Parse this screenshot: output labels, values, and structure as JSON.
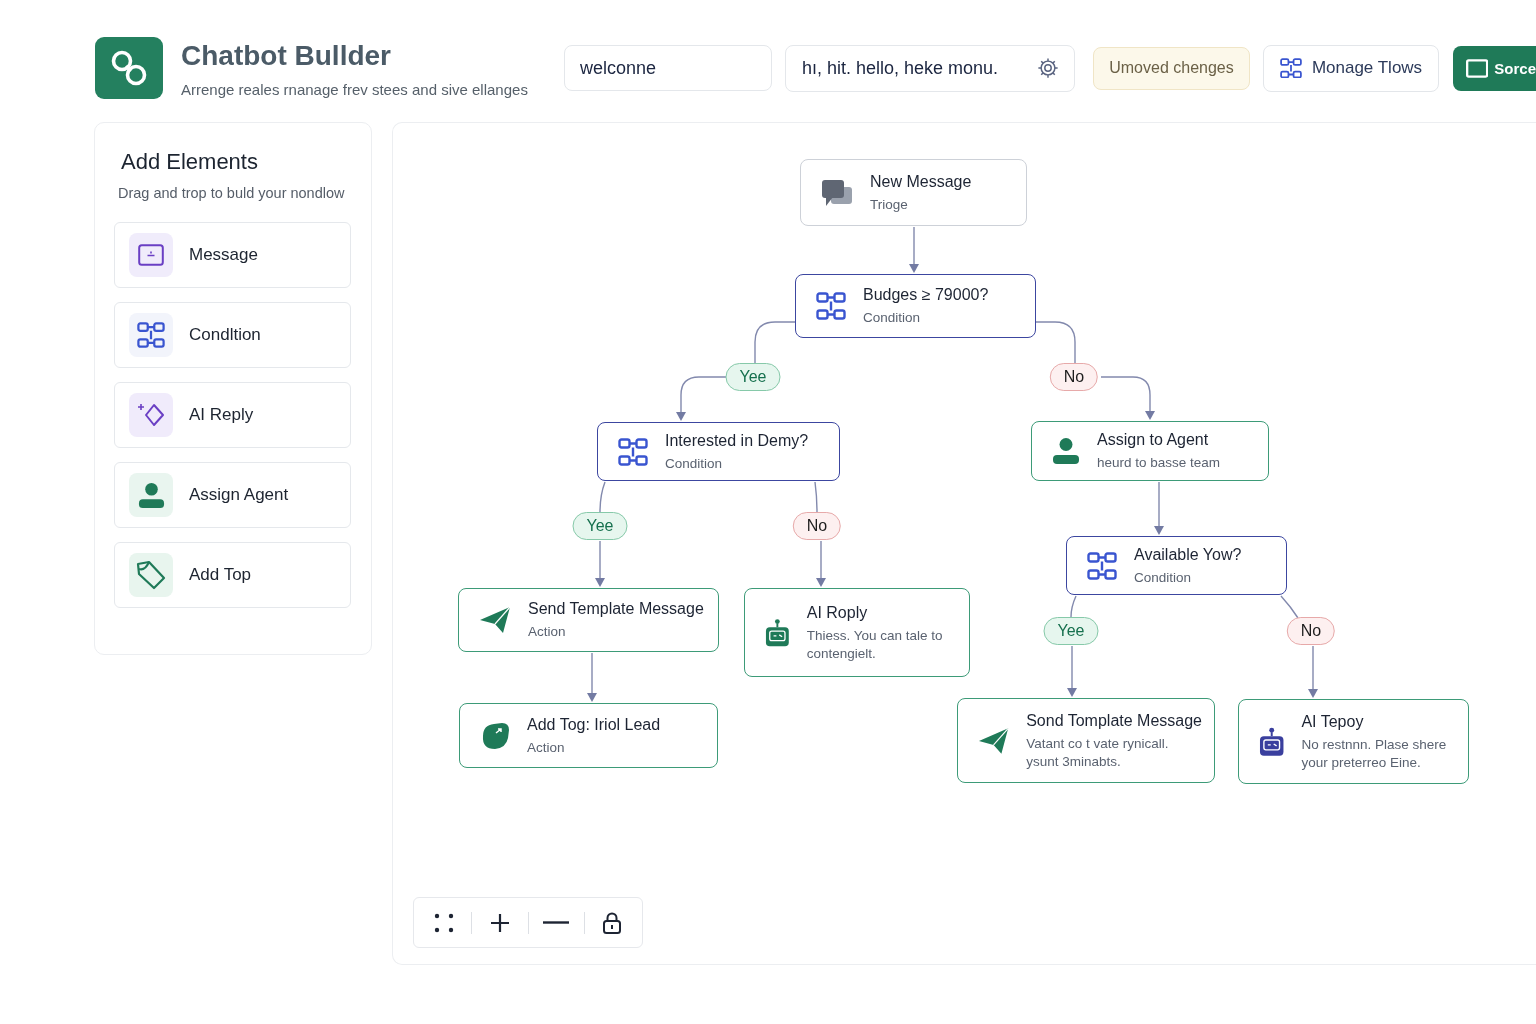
{
  "header": {
    "title": "Chatbot Bullder",
    "subtitle": "Arrenge reales rnanage frev stees and sive ellanges",
    "flow_name_field": {
      "value": "welconne"
    },
    "keywords_field": {
      "value": "hı, hit. hello, heke monu."
    },
    "status": "Umoved chenges",
    "buttons": [
      {
        "label": "Monage Tlows",
        "kind": "secondary"
      },
      {
        "label": "Sorce",
        "kind": "primary"
      }
    ]
  },
  "sidebar": {
    "title": "Add Elements",
    "subtitle": "Drag and trop to buld your nondlow",
    "items": [
      {
        "label": "Message",
        "kind": "message"
      },
      {
        "label": "Condltion",
        "kind": "condition"
      },
      {
        "label": "AI Reply",
        "kind": "ai"
      },
      {
        "label": "Assign Agent",
        "kind": "agent"
      },
      {
        "label": "Add Top",
        "kind": "tag"
      }
    ]
  },
  "flow": {
    "title": "New Message",
    "subtitle": "Trioge",
    "kind": "trigger",
    "children": [
      {
        "title": "Budges ≥ 79000?",
        "subtitle": "Condition",
        "kind": "condition",
        "children": [
          {
            "branch": {
              "label": "Yee",
              "kind": "yes"
            },
            "title": "Interested in Demy?",
            "subtitle": "Condition",
            "kind": "condition",
            "children": [
              {
                "branch": {
                  "label": "Yee",
                  "kind": "yes"
                },
                "title": "Send Template Message",
                "subtitle": "Action",
                "kind": "template",
                "children": [
                  {
                    "title": "Add Tog: Iriol Lead",
                    "subtitle": "Action",
                    "kind": "tag"
                  }
                ]
              },
              {
                "branch": {
                  "label": "No",
                  "kind": "no"
                },
                "title": "AI Roply",
                "subtitle": "Thiess. You can tale to contengielt.",
                "kind": "ai"
              }
            ]
          },
          {
            "branch": {
              "label": "No",
              "kind": "no"
            },
            "title": "Assign to Agent",
            "subtitle": "heurd to basse team",
            "kind": "agent",
            "children": [
              {
                "title": "Available Yow?",
                "subtitle": "Condition",
                "kind": "condition",
                "children": [
                  {
                    "branch": {
                      "label": "Yee",
                      "kind": "yes"
                    },
                    "title": "Sond Tomplate Message",
                    "subtitle": "Vatant co t vate rynicall. ysunt 3minabts.",
                    "kind": "template"
                  },
                  {
                    "branch": {
                      "label": "No",
                      "kind": "no"
                    },
                    "title": "AI Tepoy",
                    "subtitle": "No restnnn. Plase shere your preterreo Eine.",
                    "kind": "ai"
                  }
                ]
              }
            ]
          }
        ]
      }
    ]
  }
}
